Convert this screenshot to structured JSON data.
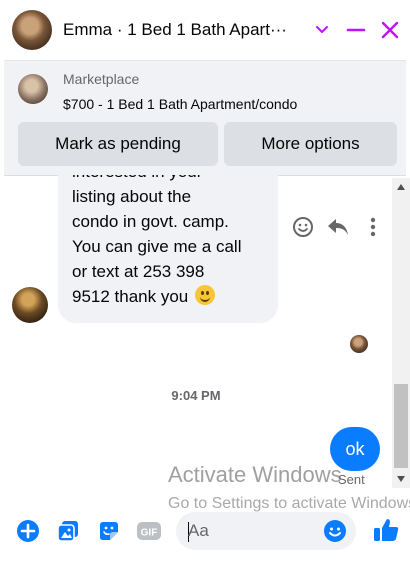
{
  "header": {
    "contact_name": "Emma",
    "title": "Emma · 1 Bed 1 Bath Apart···",
    "controls": [
      "chevron-down-icon",
      "minimize-icon",
      "close-icon"
    ]
  },
  "marketplace": {
    "label": "Marketplace",
    "listing": "$700 - 1 Bed 1 Bath Apartment/condo",
    "mark_pending_label": "Mark as pending",
    "more_options_label": "More options"
  },
  "conversation": {
    "incoming_lines": [
      "interested in your",
      "listing about the",
      "condo in govt. camp.",
      "You can give me a call",
      "or text at 253 398",
      "9512 thank you"
    ],
    "incoming_emoji": "smiling-face",
    "message_actions": [
      "react-icon",
      "reply-icon",
      "more-icon"
    ],
    "timestamp": "9:04 PM",
    "outgoing_message": "ok",
    "outgoing_status": "Sent"
  },
  "watermark": {
    "title": "Activate Windows",
    "subtitle": "Go to Settings to activate Windows."
  },
  "composer": {
    "placeholder": "Aa",
    "gif_label": "GIF",
    "icons": [
      "plus-icon",
      "photo-icon",
      "sticker-icon",
      "gif-icon",
      "emoji-icon",
      "like-icon"
    ]
  },
  "colors": {
    "accent": "#0a7cff",
    "header_controls": "#bc13fe",
    "bubble_gray": "#f0f2f5"
  }
}
